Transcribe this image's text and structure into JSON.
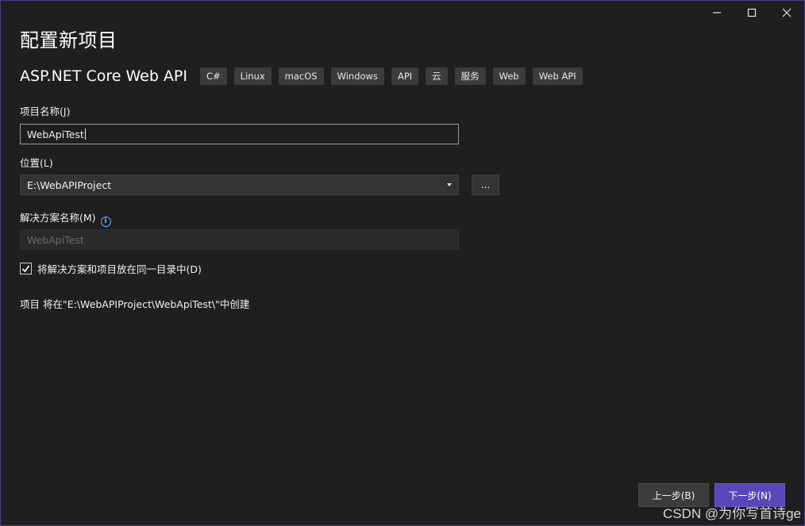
{
  "window": {
    "title": "配置新项目",
    "controls": [
      "minimize-icon",
      "maximize-icon",
      "close-icon"
    ]
  },
  "template": {
    "name": "ASP.NET Core Web API",
    "tags": [
      "C#",
      "Linux",
      "macOS",
      "Windows",
      "API",
      "云",
      "服务",
      "Web",
      "Web API"
    ]
  },
  "form": {
    "project_name_label": "项目名称(J)",
    "project_name_value": "WebApiTest",
    "location_label": "位置(L)",
    "location_value": "E:\\WebAPIProject",
    "browse_label": "...",
    "solution_name_label": "解决方案名称(M)",
    "solution_name_value": "WebApiTest",
    "same_dir_checkbox_label": "将解决方案和项目放在同一目录中(D)",
    "same_dir_checked": true,
    "path_info": "项目 将在\"E:\\WebAPIProject\\WebApiTest\\\"中创建"
  },
  "footer": {
    "back_label": "上一步(B)",
    "next_label": "下一步(N)"
  },
  "colors": {
    "background": "#1f1f1f",
    "accent": "#5a46b8",
    "window_border": "#4b3d8f",
    "info": "#6cb4ff"
  },
  "watermark": "CSDN @为你写首诗ge"
}
